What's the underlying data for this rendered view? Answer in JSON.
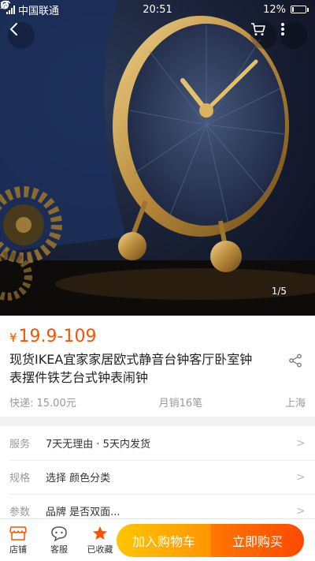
{
  "status_bar": {
    "carrier": "中国联通",
    "time": "20:51",
    "battery": "12%",
    "battery_level": 0.12
  },
  "gallery": {
    "counter": "1/5"
  },
  "product": {
    "currency": "¥",
    "price": "19.9-109",
    "title": "现货IKEA宜家家居欧式静音台钟客厅卧室钟表摆件铁艺台式钟表闹钟",
    "shipping": "快递: 15.00元",
    "sales": "月销16笔",
    "location": "上海"
  },
  "details": [
    {
      "key": "服务",
      "value": "7天无理由 · 5天内发货"
    },
    {
      "key": "规格",
      "value": "选择 颜色分类"
    },
    {
      "key": "参数",
      "value": "品牌 是否双面..."
    }
  ],
  "bottom_bar": {
    "shop": "店铺",
    "service": "客服",
    "favorited": "已收藏",
    "add_to_cart": "加入购物车",
    "buy_now": "立即购买"
  },
  "colors": {
    "price": "#ff5000",
    "favorite": "#ff5000",
    "cart_button": "#ff9402",
    "buy_button": "#ff4900"
  },
  "icons": [
    "signal-icon",
    "wifi-icon",
    "mute-icon",
    "alarm-icon",
    "battery-icon",
    "back-icon",
    "cart-icon",
    "more-icon",
    "share-icon",
    "shop-icon",
    "service-icon",
    "star-icon",
    "chevron-right-icon"
  ]
}
